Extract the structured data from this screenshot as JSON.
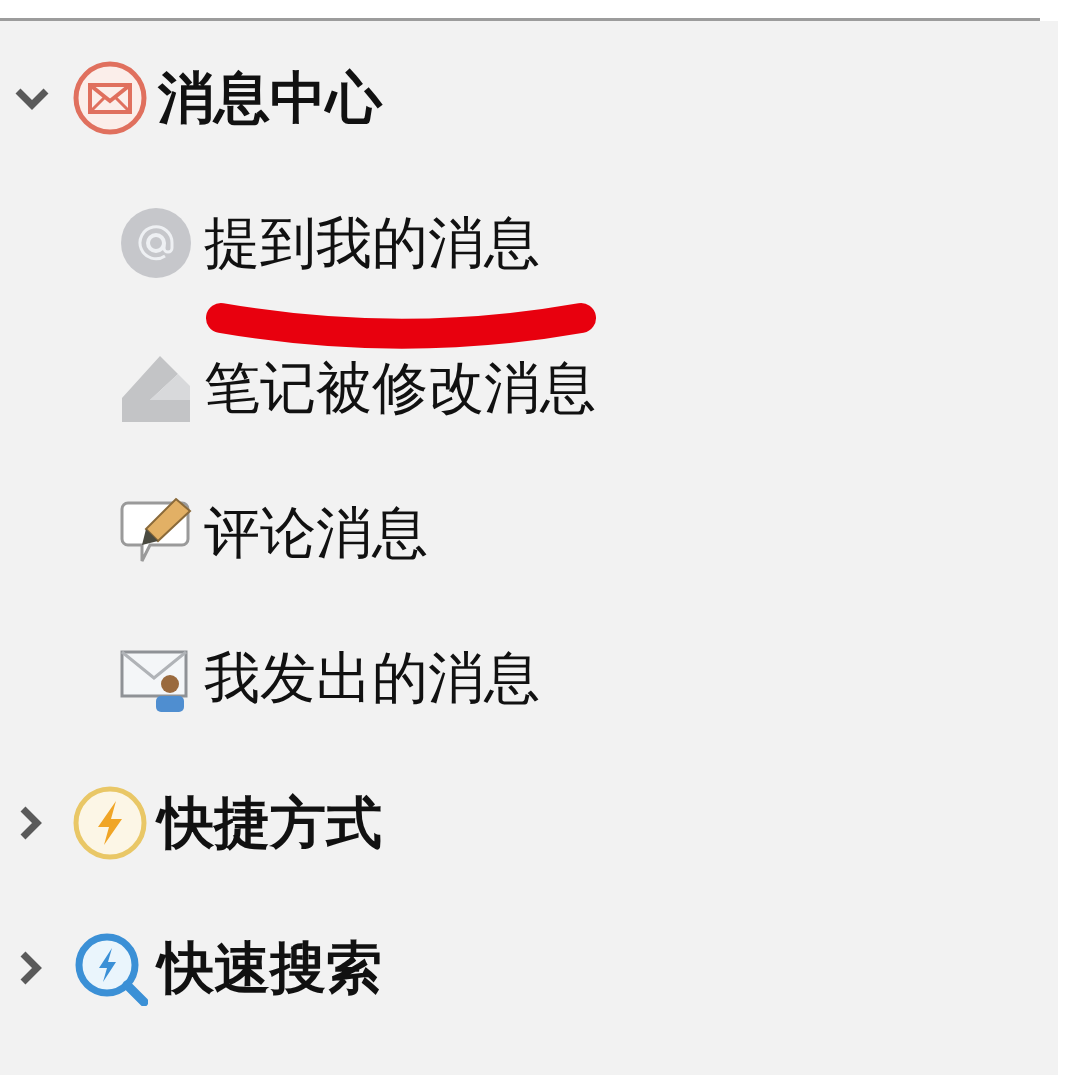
{
  "tree": [
    {
      "label": "消息中心",
      "expanded": true,
      "children": [
        {
          "label": "提到我的消息"
        },
        {
          "label": "笔记被修改消息"
        },
        {
          "label": "评论消息"
        },
        {
          "label": "我发出的消息"
        }
      ]
    },
    {
      "label": "快捷方式",
      "expanded": false
    },
    {
      "label": "快速搜索",
      "expanded": false
    }
  ]
}
